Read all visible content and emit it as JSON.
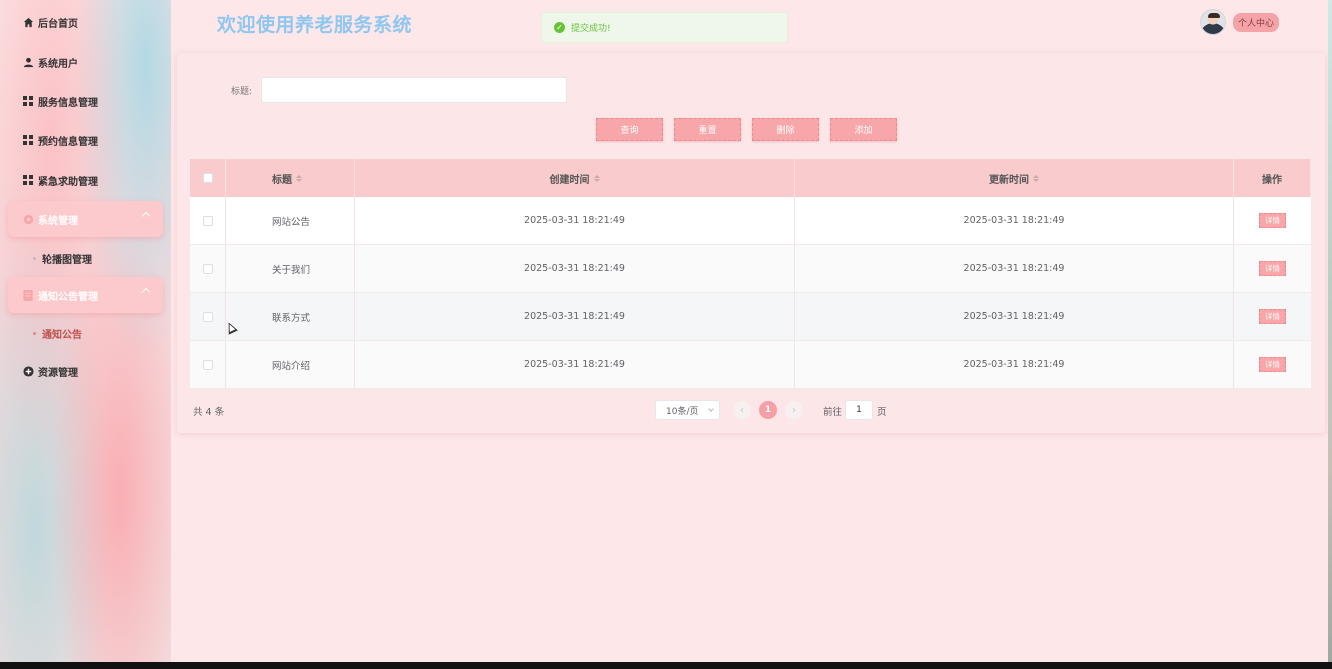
{
  "sidebar": {
    "items": [
      {
        "label": "后台首页",
        "icon": "home-icon"
      },
      {
        "label": "系统用户",
        "icon": "user-icon"
      },
      {
        "label": "服务信息管理",
        "icon": "grid-icon"
      },
      {
        "label": "预约信息管理",
        "icon": "grid-icon"
      },
      {
        "label": "紧急求助管理",
        "icon": "grid-icon"
      },
      {
        "label": "系统管理",
        "icon": "settings-icon"
      },
      {
        "label": "通知公告管理",
        "icon": "document-icon"
      },
      {
        "label": "资源管理",
        "icon": "plus-circle-icon"
      }
    ],
    "sub_items": {
      "system": "轮播图管理",
      "notice": "通知公告"
    }
  },
  "header": {
    "title": "欢迎使用养老服务系统",
    "toast": "提交成功!",
    "personal_center": "个人中心"
  },
  "search": {
    "label": "标题:",
    "value": "",
    "placeholder": ""
  },
  "actions": {
    "query": "查询",
    "reset": "重置",
    "delete": "删除",
    "add": "添加"
  },
  "table": {
    "columns": [
      "标题",
      "创建时间",
      "更新时间",
      "操作"
    ],
    "rows": [
      {
        "title": "网站公告",
        "created": "2025-03-31 18:21:49",
        "updated": "2025-03-31 18:21:49",
        "action": "详情"
      },
      {
        "title": "关于我们",
        "created": "2025-03-31 18:21:49",
        "updated": "2025-03-31 18:21:49",
        "action": "详情"
      },
      {
        "title": "联系方式",
        "created": "2025-03-31 18:21:49",
        "updated": "2025-03-31 18:21:49",
        "action": "详情"
      },
      {
        "title": "网站介绍",
        "created": "2025-03-31 18:21:49",
        "updated": "2025-03-31 18:21:49",
        "action": "详情"
      }
    ]
  },
  "pagination": {
    "total": "共 4 条",
    "page_size": "10条/页",
    "current_page": "1",
    "goto_label": "前往",
    "goto_value": "1",
    "goto_suffix": "页"
  },
  "colors": {
    "accent": "#f7a6a9",
    "title": "#8fc7f0",
    "success": "#67c23a"
  }
}
